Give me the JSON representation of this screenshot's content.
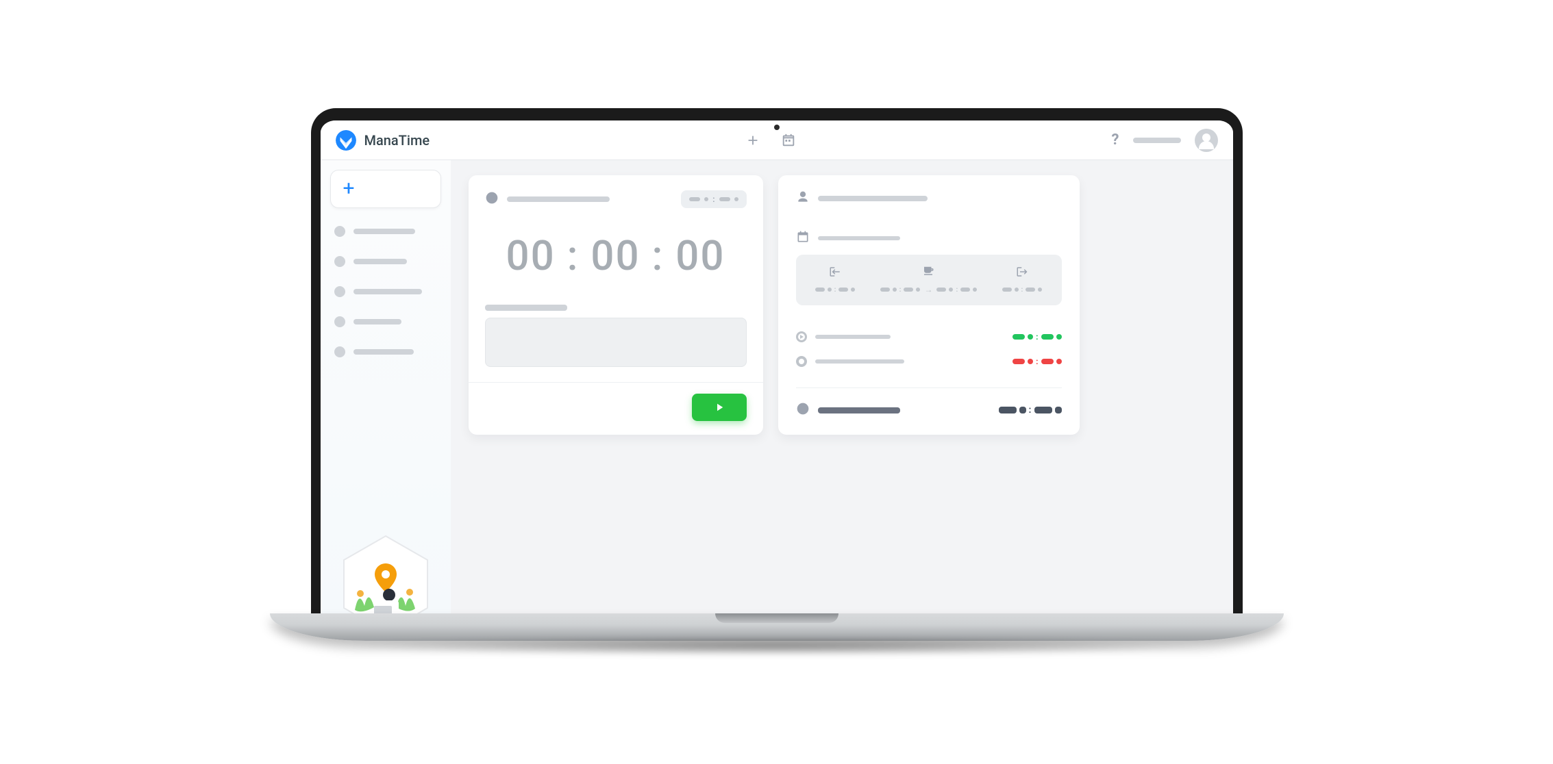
{
  "brand": {
    "name": "ManaTime"
  },
  "topbar": {
    "help_label": "?",
    "user_name_placeholder": ""
  },
  "sidebar": {
    "add_label": "+",
    "items": [
      {
        "label": ""
      },
      {
        "label": ""
      },
      {
        "label": ""
      },
      {
        "label": ""
      },
      {
        "label": ""
      }
    ]
  },
  "timer": {
    "title": "",
    "badge": "",
    "display": "00 : 00 : 00",
    "notes_label": "",
    "notes_placeholder": "",
    "notes_value": ""
  },
  "summary": {
    "user_label": "",
    "date_label": "",
    "schedule": {
      "arrival": {
        "icon": "login",
        "value": ""
      },
      "break": {
        "icon": "coffee",
        "value_from": "",
        "value_to": ""
      },
      "departure": {
        "icon": "logout",
        "value": ""
      }
    },
    "rows": [
      {
        "icon": "play",
        "label": "",
        "color": "green",
        "value": ""
      },
      {
        "icon": "ring",
        "label": "",
        "color": "red",
        "value": ""
      }
    ],
    "total": {
      "icon": "clock",
      "label": "",
      "value": ""
    }
  },
  "colors": {
    "accent_blue": "#1e88ff",
    "play_green": "#27c240",
    "status_green": "#22c55e",
    "status_red": "#ef4444",
    "text_muted": "#9ca3af"
  }
}
